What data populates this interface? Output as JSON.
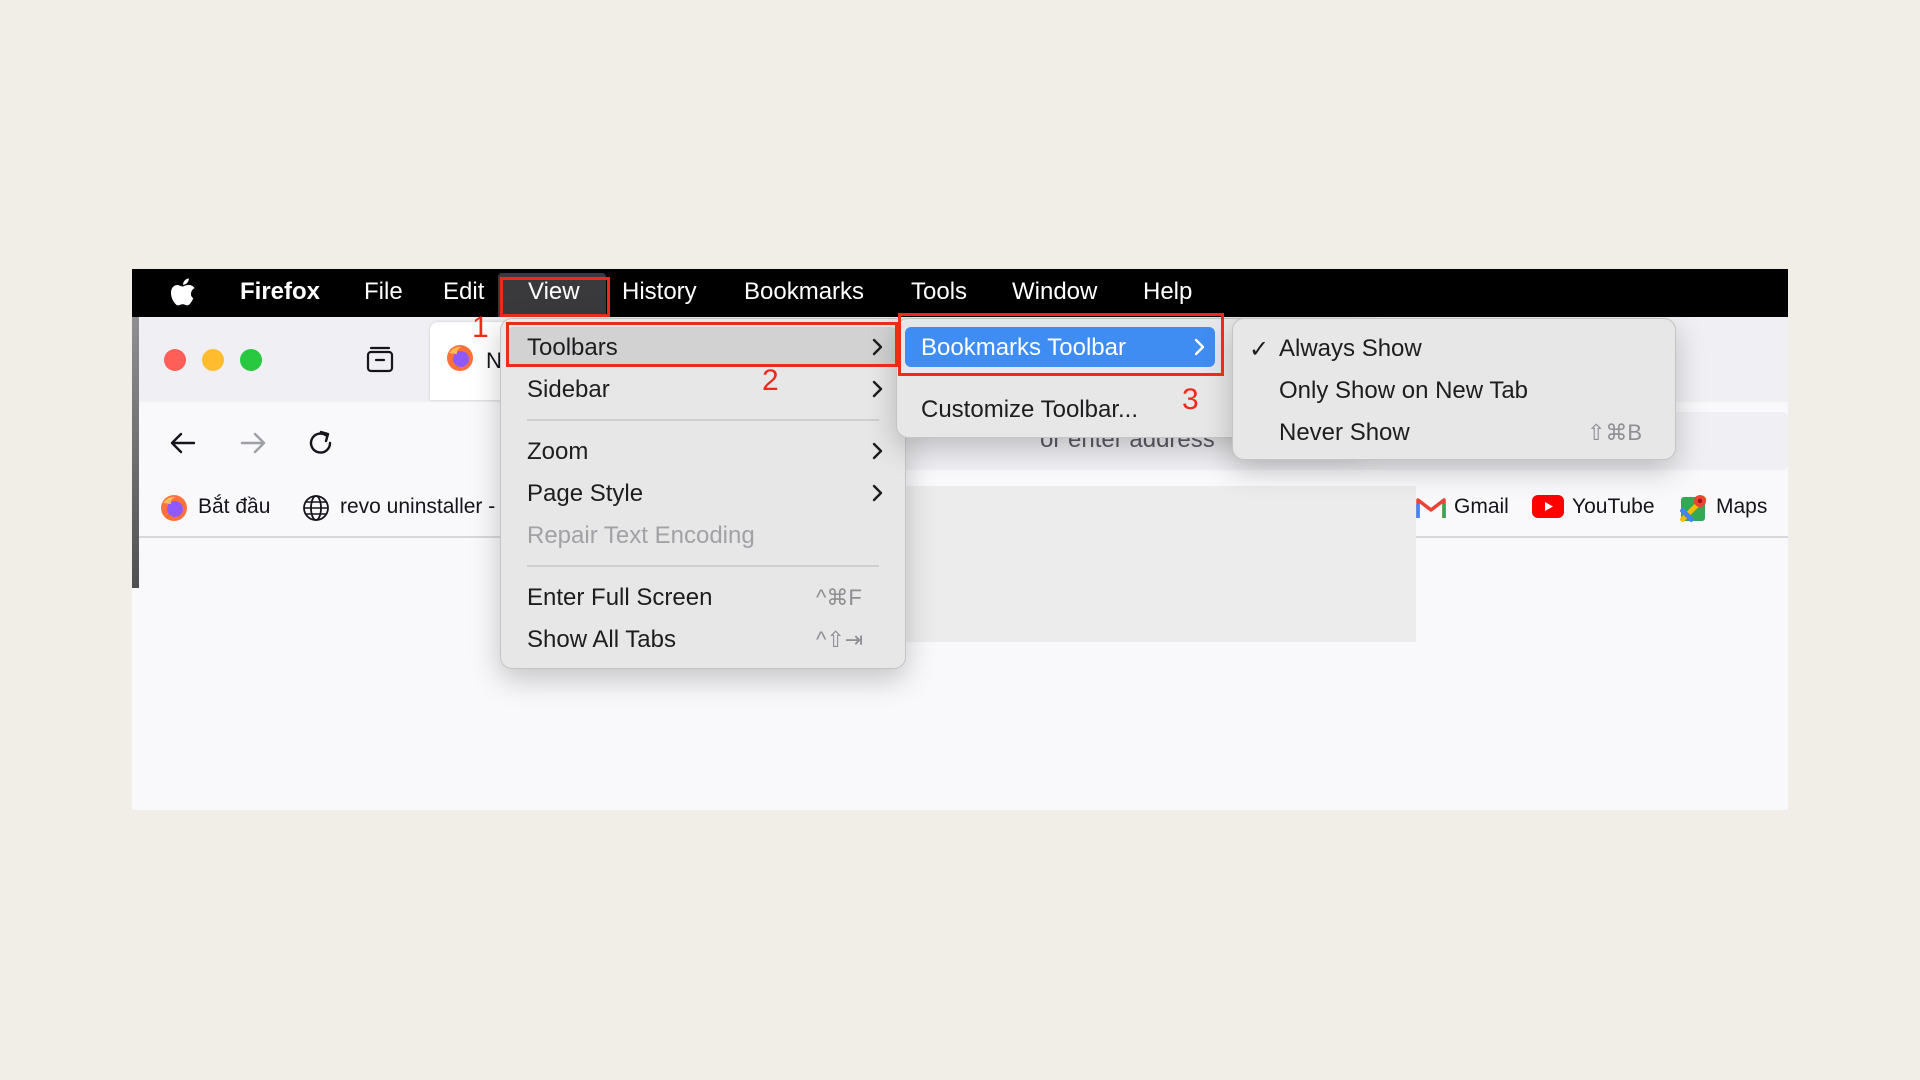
{
  "menubar": {
    "app_name": "Firefox",
    "items": [
      "File",
      "Edit",
      "View",
      "History",
      "Bookmarks",
      "Tools",
      "Window",
      "Help"
    ]
  },
  "browser": {
    "tab_title_partial": "N",
    "url_placeholder_partial": "or enter address",
    "bookmarks": [
      {
        "label": "Bắt đầu",
        "icon": "firefox-icon"
      },
      {
        "label": "revo uninstaller -",
        "icon": "globe-icon"
      },
      {
        "label": "Gmail",
        "icon": "gmail-icon"
      },
      {
        "label": "YouTube",
        "icon": "youtube-icon"
      },
      {
        "label": "Maps",
        "icon": "maps-icon"
      }
    ]
  },
  "view_menu": {
    "items": [
      {
        "label": "Toolbars",
        "submenu": true
      },
      {
        "label": "Sidebar",
        "submenu": true
      },
      {
        "label": "Zoom",
        "submenu": true
      },
      {
        "label": "Page Style",
        "submenu": true
      },
      {
        "label": "Repair Text Encoding",
        "disabled": true
      },
      {
        "label": "Enter Full Screen",
        "shortcut": "^⌘F"
      },
      {
        "label": "Show All Tabs",
        "shortcut": "^⇧⇥"
      }
    ]
  },
  "toolbars_menu": {
    "items": [
      {
        "label": "Bookmarks Toolbar",
        "submenu": true
      },
      {
        "label": "Customize Toolbar..."
      }
    ]
  },
  "bookmarks_toolbar_menu": {
    "items": [
      {
        "label": "Always Show",
        "checked": true,
        "check_mark": "✓"
      },
      {
        "label": "Only Show on New Tab"
      },
      {
        "label": "Never Show",
        "shortcut": "⇧⌘B"
      }
    ]
  },
  "annotations": [
    "1",
    "2",
    "3"
  ],
  "colors": {
    "menubar_bg": "#000000",
    "menu_bg": "#e7e7e7",
    "selection_blue": "#3f8cf2",
    "annotation_red": "#ee2b1b",
    "close": "#ff5f57",
    "minimize": "#febc2e",
    "zoom": "#28c840"
  }
}
